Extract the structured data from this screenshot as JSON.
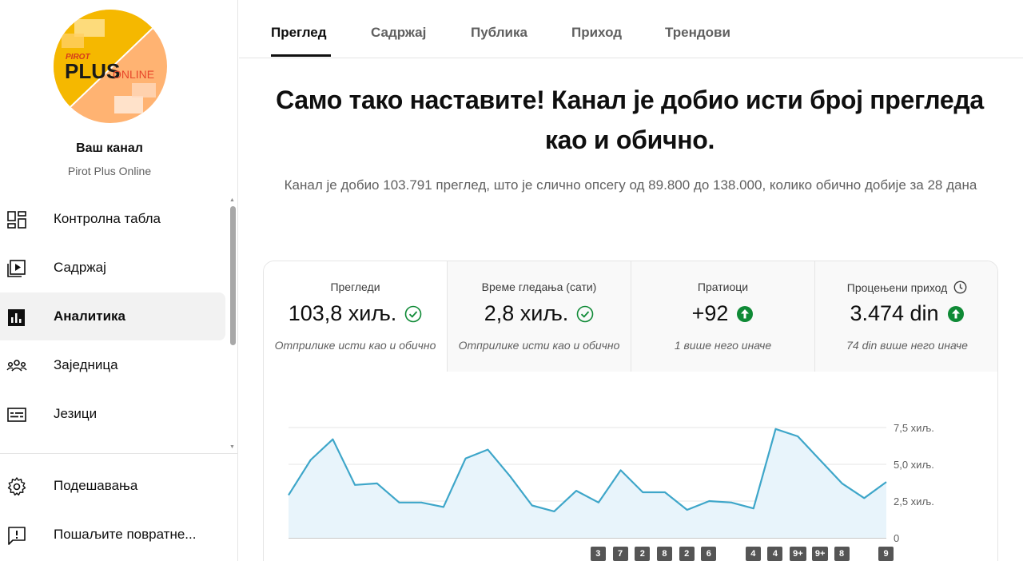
{
  "sidebar": {
    "avatar": {
      "logo_top": "PIROT",
      "logo_main": "PLUS",
      "logo_sub": "ONLINE",
      "colors": {
        "yellow": "#f5b800",
        "peach": "#ffb372"
      }
    },
    "title": "Ваш канал",
    "channel_name": "Pirot Plus Online",
    "items": [
      {
        "label": "Контролна табла",
        "icon": "dashboard-icon"
      },
      {
        "label": "Садржај",
        "icon": "content-icon"
      },
      {
        "label": "Аналитика",
        "icon": "analytics-icon",
        "active": true
      },
      {
        "label": "Заједница",
        "icon": "community-icon"
      },
      {
        "label": "Језици",
        "icon": "subtitles-icon"
      }
    ],
    "bottom_items": [
      {
        "label": "Подешавања",
        "icon": "gear-icon"
      },
      {
        "label": "Пошаљите повратне...",
        "icon": "feedback-icon"
      }
    ]
  },
  "tabs": [
    "Преглед",
    "Садржај",
    "Публика",
    "Приход",
    "Трендови"
  ],
  "active_tab": "Преглед",
  "headline": "Само тако наставите! Канал је добио исти број прегледа као и обично.",
  "subtext": "Канал је добио 103.791 преглед, што је слично опсегу од 89.800 до 138.000, колико обично добије за 28 дана",
  "metrics": [
    {
      "label": "Прегледи",
      "value": "103,8 хиљ.",
      "note": "Отприлике исти као и обично",
      "indicator": "check-circle-icon"
    },
    {
      "label": "Време гледања (сати)",
      "value": "2,8 хиљ.",
      "note": "Отприлике исти као и обично",
      "indicator": "check-circle-icon"
    },
    {
      "label": "Пратиоци",
      "value": "+92",
      "note": "1 више него иначе",
      "indicator": "arrow-up-icon"
    },
    {
      "label": "Процењени приход",
      "value": "3.474 din",
      "note": "74 din више него иначе",
      "indicator": "arrow-up-icon",
      "has_info_icon": true
    }
  ],
  "colors": {
    "accent_line": "#3ea6c9",
    "area_fill": "#e8f4fb",
    "green": "#0f8a36",
    "badge": "#555555"
  },
  "chart_data": {
    "type": "area",
    "series": [
      {
        "values": [
          2900,
          5300,
          6700,
          3600,
          3700,
          2400,
          2400,
          2100,
          5400,
          6000,
          4200,
          2200,
          1800,
          3200,
          2400,
          4600,
          3100,
          3100,
          1900,
          2500,
          2400,
          2000,
          7400,
          6900,
          5300,
          3700,
          2700,
          3800
        ]
      }
    ],
    "y_ticks": [
      "7,5 хиљ.",
      "5,0 хиљ.",
      "2,5 хиљ.",
      "0"
    ],
    "ylim": [
      0,
      7500
    ],
    "video_badges": [
      {
        "day": 15,
        "label": "3"
      },
      {
        "day": 16,
        "label": "7"
      },
      {
        "day": 17,
        "label": "2"
      },
      {
        "day": 18,
        "label": "8"
      },
      {
        "day": 19,
        "label": "2"
      },
      {
        "day": 20,
        "label": "6"
      },
      {
        "day": 22,
        "label": "4"
      },
      {
        "day": 23,
        "label": "4"
      },
      {
        "day": 24,
        "label": "9+"
      },
      {
        "day": 25,
        "label": "9+"
      },
      {
        "day": 26,
        "label": "8"
      },
      {
        "day": 28,
        "label": "9"
      }
    ]
  }
}
